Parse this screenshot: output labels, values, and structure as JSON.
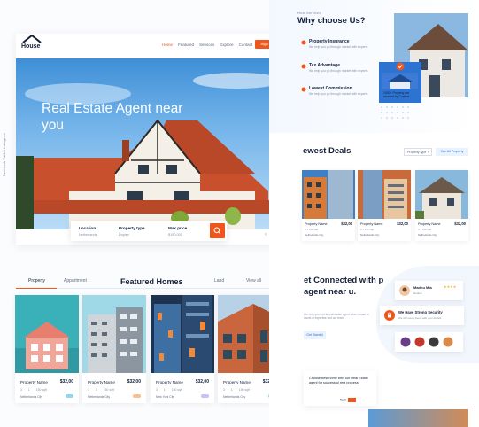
{
  "brand": {
    "logo_text": "House"
  },
  "nav": {
    "items": [
      "Home",
      "Featured",
      "Services",
      "Explore",
      "Contact"
    ],
    "signup": "Sign up"
  },
  "social": "Facebook     Twitter     Instagram",
  "hero": {
    "title": "Real Estate Agent near you"
  },
  "search": {
    "location_label": "Location",
    "location_value": "Netherlands",
    "type_label": "Property type",
    "type_value": "Duplex",
    "price_label": "Max price",
    "price_value": "$150,000"
  },
  "featured": {
    "tabs": [
      "Property",
      "Appartment",
      "Land",
      "View all"
    ],
    "title": "Featured Homes",
    "cards": [
      {
        "name": "Property Name",
        "price": "$32,00",
        "beds": "3",
        "baths": "1",
        "area": "150 sqft",
        "location": "Netherlands City",
        "badge_color": "#8fd6f0"
      },
      {
        "name": "Property Name",
        "price": "$32,00",
        "beds": "3",
        "baths": "1",
        "area": "150 sqft",
        "location": "Netherlands City",
        "badge_color": "#f8c08e"
      },
      {
        "name": "Property Name",
        "price": "$32,00",
        "beds": "3",
        "baths": "1",
        "area": "150 sqft",
        "location": "New York City",
        "badge_color": "#c8c2f4"
      },
      {
        "name": "Property Name",
        "price": "$32,00",
        "beds": "3",
        "baths": "1",
        "area": "150 sqft",
        "location": "Netherlands City",
        "badge_color": "#8fd6f0"
      }
    ]
  },
  "why": {
    "label": "Real Services",
    "title": "Why choose Us?",
    "features": [
      {
        "title": "Property Insurance",
        "desc": "We help you go through market with experts."
      },
      {
        "title": "Tax Advantage",
        "desc": "We help you go through market with experts."
      },
      {
        "title": "Lowest Commission",
        "desc": "We help you go through market with experts."
      }
    ],
    "highlight": "1000+ Property are secured by Codeist"
  },
  "deals": {
    "title": "ewest Deals",
    "select": "Property type",
    "button": "See All Property",
    "cards": [
      {
        "name": "Property Name",
        "price": "$32,00",
        "meta": "3   1   150 sqft",
        "location": "Netherlands City"
      },
      {
        "name": "Property Name",
        "price": "$32,00",
        "meta": "3   1   150 sqft",
        "location": "Netherlands City"
      },
      {
        "name": "Property Name",
        "price": "$32,00",
        "meta": "3   1   150 sqft",
        "location": "Netherlands City"
      }
    ]
  },
  "connect": {
    "title": "et Connected with p agent near u.",
    "desc": "We help you find to real estate agent when house to invest of expertise and our team.",
    "button": "Get Started",
    "agent_name": "Madhu Mia",
    "agent_role": "Realtor",
    "security": "We Have Strong Security",
    "security_sub": "We will surely keep safe your details",
    "bottom_text": "Choose best home with our Real Estate agent for successful rent process.",
    "next": "Next"
  }
}
